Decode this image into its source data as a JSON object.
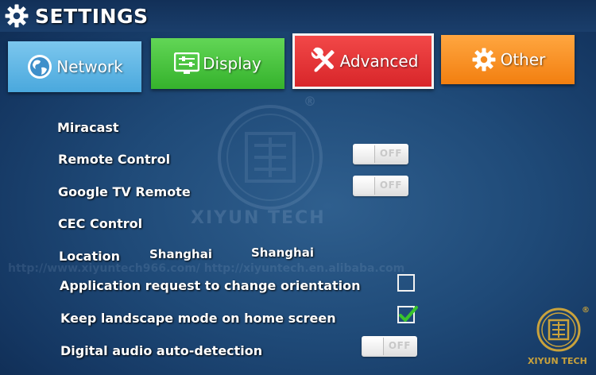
{
  "header": {
    "title": "SETTINGS",
    "icon": "gear-icon"
  },
  "tabs": [
    {
      "id": "network",
      "label": "Network",
      "icon": "globe-icon",
      "color": "#5ab4e4"
    },
    {
      "id": "display",
      "label": "Display",
      "icon": "display-sliders-icon",
      "color": "#43c23a"
    },
    {
      "id": "advanced",
      "label": "Advanced",
      "icon": "wrench-screwdriver-icon",
      "color": "#e2302f",
      "selected": true
    },
    {
      "id": "other",
      "label": "Other",
      "icon": "gear-icon",
      "color": "#f48a1e"
    }
  ],
  "settings": [
    {
      "label": "Miracast"
    },
    {
      "label": "Remote Control",
      "toggle": "OFF"
    },
    {
      "label": "Google TV Remote",
      "toggle": "OFF"
    },
    {
      "label": "CEC Control"
    },
    {
      "label": "Location",
      "value1": "Shanghai",
      "value2": "Shanghai"
    },
    {
      "label": "Application request to change orientation",
      "checked": false
    },
    {
      "label": "Keep landscape mode on home screen",
      "checked": true
    },
    {
      "label": "Digital audio auto-detection",
      "toggle": "OFF"
    }
  ],
  "watermarks": {
    "center_text": "XIYUN TECH",
    "url_text": "http://www.xiyuntech966.com/   http://xiyuntech.en.alibaba.com",
    "corner_text": "XIYUN TECH",
    "registered": "®"
  }
}
